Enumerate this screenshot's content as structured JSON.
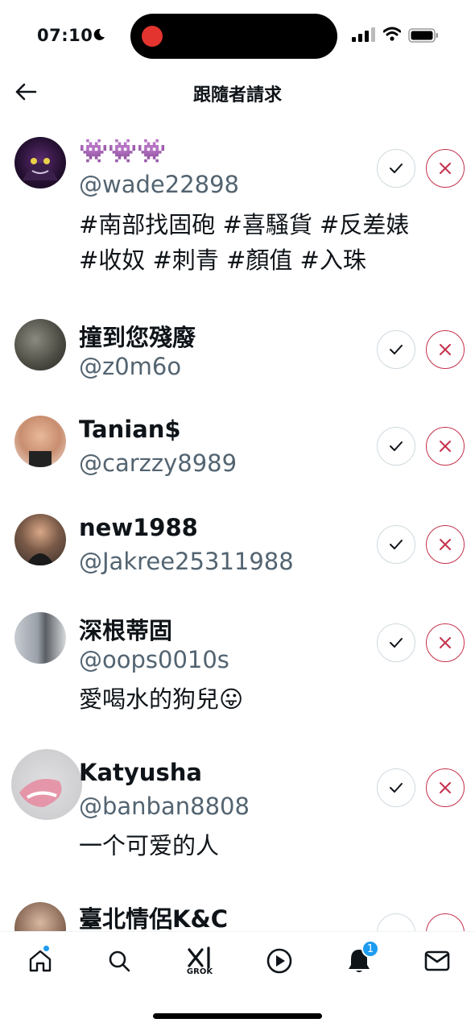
{
  "status_bar": {
    "time": "07:10"
  },
  "header": {
    "title": "跟隨者請求"
  },
  "requests": [
    {
      "name": "👾👾👾",
      "handle": "@wade22898",
      "bio": [
        "#南部找固砲 #喜騷貨 #反差婊",
        "#收奴 #刺青 #顏值 #入珠"
      ]
    },
    {
      "name": "撞到您殘廢",
      "handle": "@z0m6o",
      "bio": []
    },
    {
      "name": "Tanian$",
      "handle": "@carzzy8989",
      "bio": []
    },
    {
      "name": "new1988",
      "handle": "@Jakree25311988",
      "bio": []
    },
    {
      "name": "深根蒂固",
      "handle": "@oops0010s",
      "bio": [
        "愛喝水的狗兒😛"
      ]
    },
    {
      "name": "Katyusha",
      "handle": "@banban8808",
      "bio": [
        "一个可爱的人"
      ]
    },
    {
      "name": "臺北情侶K&C",
      "handle": "",
      "bio": []
    }
  ],
  "bottom_nav": {
    "items": [
      "home-icon",
      "search-icon",
      "grok-icon",
      "video-icon",
      "notifications-icon",
      "messages-icon"
    ],
    "grok_label": "GROK",
    "notification_count": "1"
  },
  "colors": {
    "accent": "#1d9bf0",
    "reject": "#c4314b",
    "secondary_text": "#536471",
    "record_dot": "#e4342f"
  }
}
